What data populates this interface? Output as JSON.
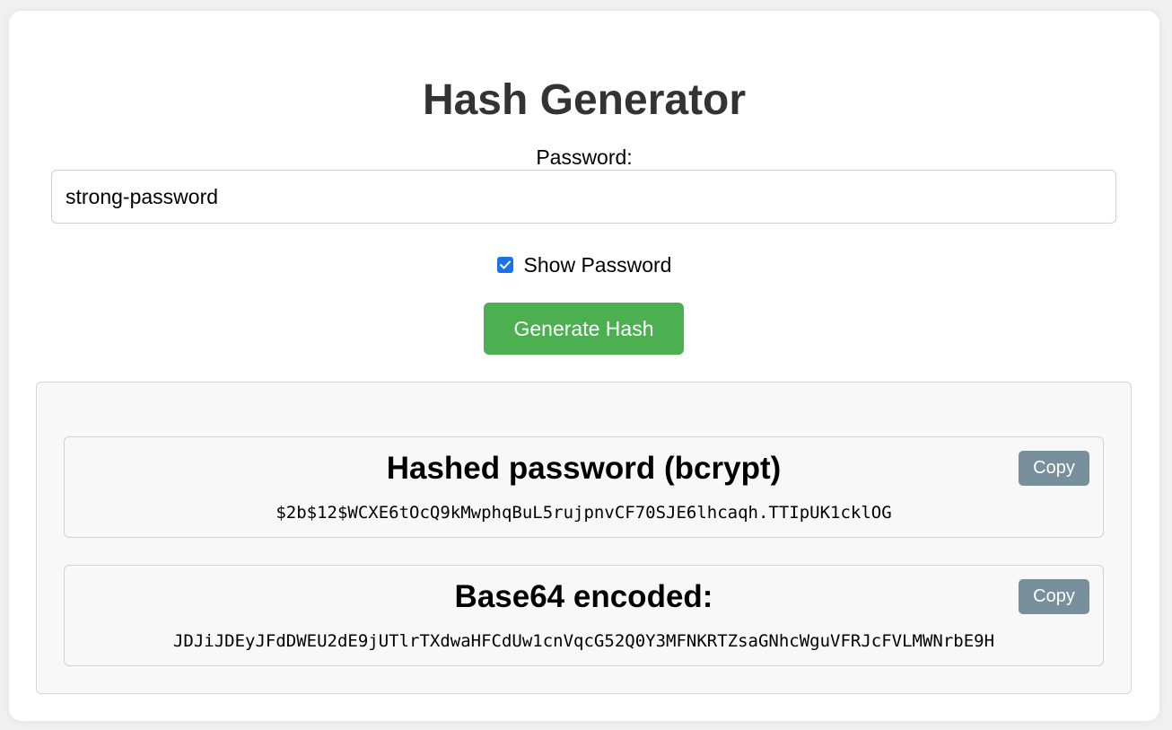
{
  "page": {
    "title": "Hash Generator"
  },
  "form": {
    "password_label": "Password:",
    "password_value": "strong-password",
    "show_password_label": "Show Password",
    "show_password_checked": true,
    "generate_button_label": "Generate Hash"
  },
  "results": {
    "bcrypt": {
      "title": "Hashed password (bcrypt)",
      "value": "$2b$12$WCXE6tOcQ9kMwphqBuL5rujpnvCF70SJE6lhcaqh.TTIpUK1cklOG",
      "copy_label": "Copy"
    },
    "base64": {
      "title": "Base64 encoded:",
      "value": "JDJiJDEyJFdDWEU2dE9jUTlrTXdwaHFCdUw1cnVqcG52Q0Y3MFNKRTZsaGNhcWguVFRJcFVLMWNrbE9H",
      "copy_label": "Copy"
    }
  },
  "colors": {
    "generate_button": "#4caf50",
    "copy_button": "#78909c",
    "checkbox": "#1a73e8",
    "title_text": "#333333"
  }
}
